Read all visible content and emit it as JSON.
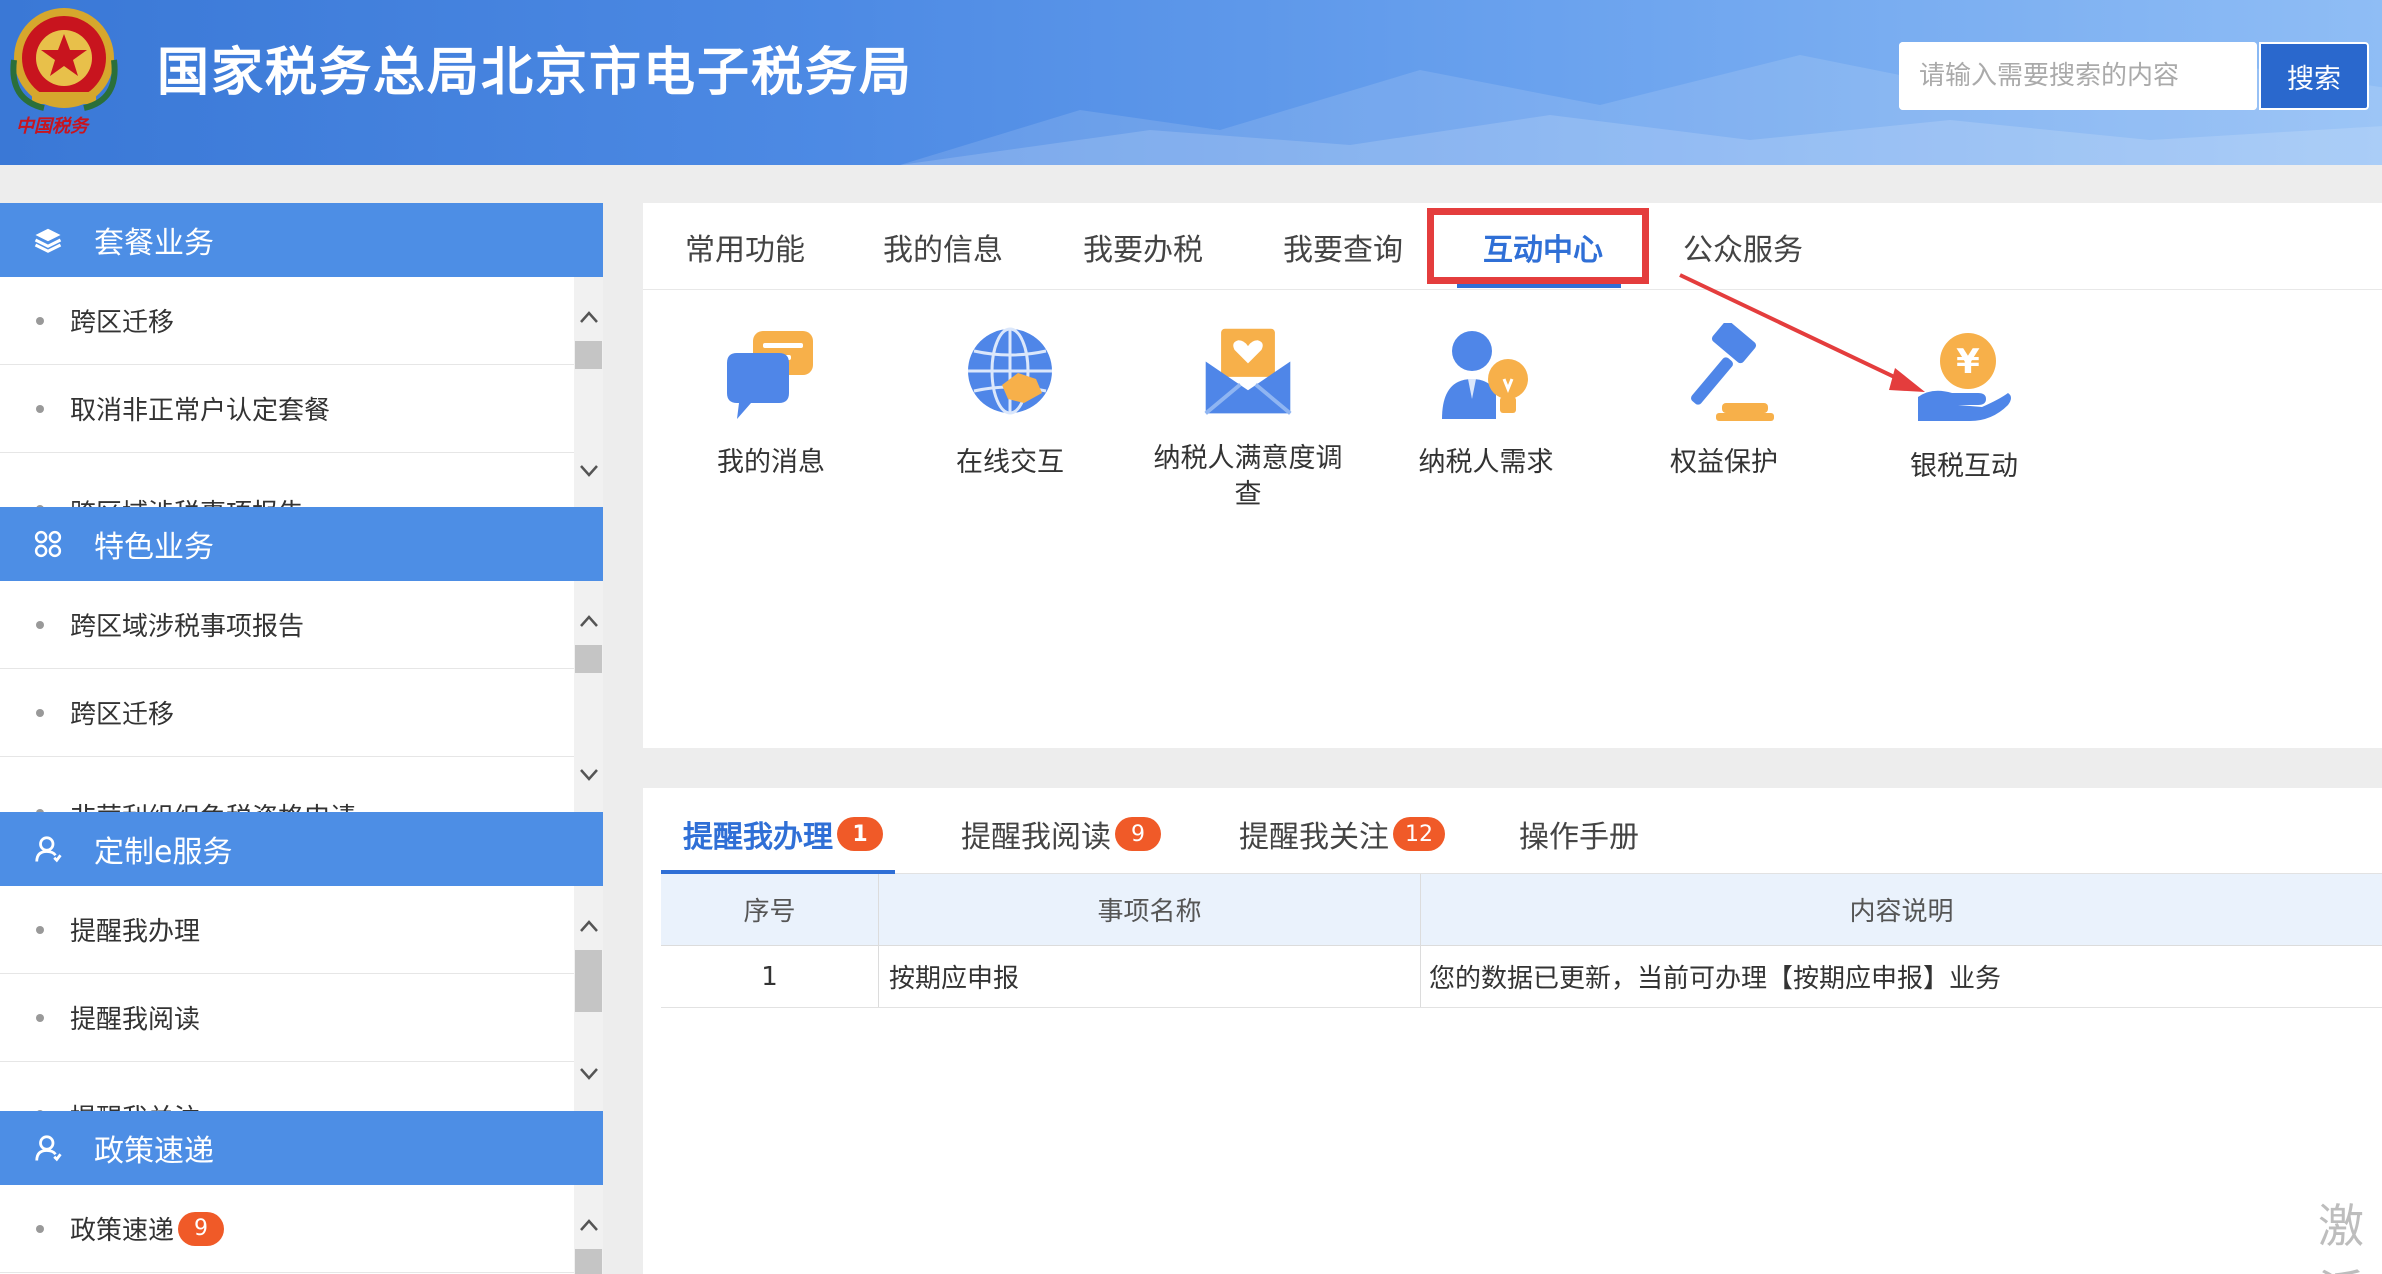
{
  "header": {
    "site_title": "国家税务总局北京市电子税务局",
    "logo_sign": "中国税务",
    "search_placeholder": "请输入需要搜索的内容",
    "search_button": "搜索"
  },
  "sidebar": {
    "sections": [
      {
        "title": "套餐业务",
        "icon": "layers-icon",
        "items": [
          "跨区迁移",
          "取消非正常户认定套餐",
          "跨区域涉税事项报告"
        ]
      },
      {
        "title": "特色业务",
        "icon": "apps-grid-icon",
        "items": [
          "跨区域涉税事项报告",
          "跨区迁移",
          "非营利组织免税资格申请"
        ]
      },
      {
        "title": "定制e服务",
        "icon": "user-icon",
        "items": [
          "提醒我办理",
          "提醒我阅读",
          "提醒我关注"
        ]
      },
      {
        "title": "政策速递",
        "icon": "user-icon",
        "items": [
          "政策速递"
        ],
        "item_badge": "9"
      }
    ]
  },
  "main": {
    "tabs": [
      "常用功能",
      "我的信息",
      "我要办税",
      "我要查询",
      "互动中心",
      "公众服务"
    ],
    "active_tab": "互动中心",
    "functions": [
      {
        "label": "我的消息",
        "icon": "message-bubble-icon"
      },
      {
        "label": "在线交互",
        "icon": "globe-handshake-icon"
      },
      {
        "label": "纳税人满意度调查",
        "icon": "heart-envelope-icon"
      },
      {
        "label": "纳税人需求",
        "icon": "person-lightbulb-icon"
      },
      {
        "label": "权益保护",
        "icon": "gavel-icon"
      },
      {
        "label": "银税互动",
        "icon": "yuan-coin-hand-icon"
      }
    ]
  },
  "reminders": {
    "tabs": [
      {
        "label": "提醒我办理",
        "count": "1"
      },
      {
        "label": "提醒我阅读",
        "count": "9"
      },
      {
        "label": "提醒我关注",
        "count": "12"
      },
      {
        "label": "操作手册",
        "count": ""
      }
    ],
    "active_tab": "提醒我办理",
    "table": {
      "headers": [
        "序号",
        "事项名称",
        "内容说明"
      ],
      "rows": [
        [
          "1",
          "按期应申报",
          "您的数据已更新，当前可办理【按期应申报】业务"
        ]
      ]
    }
  },
  "watermark": "激活",
  "colors": {
    "header_blue": "#4d8ae4",
    "accent_blue": "#2f6fd6",
    "badge_orange": "#f05a28",
    "highlight_red": "#e43d3d"
  }
}
